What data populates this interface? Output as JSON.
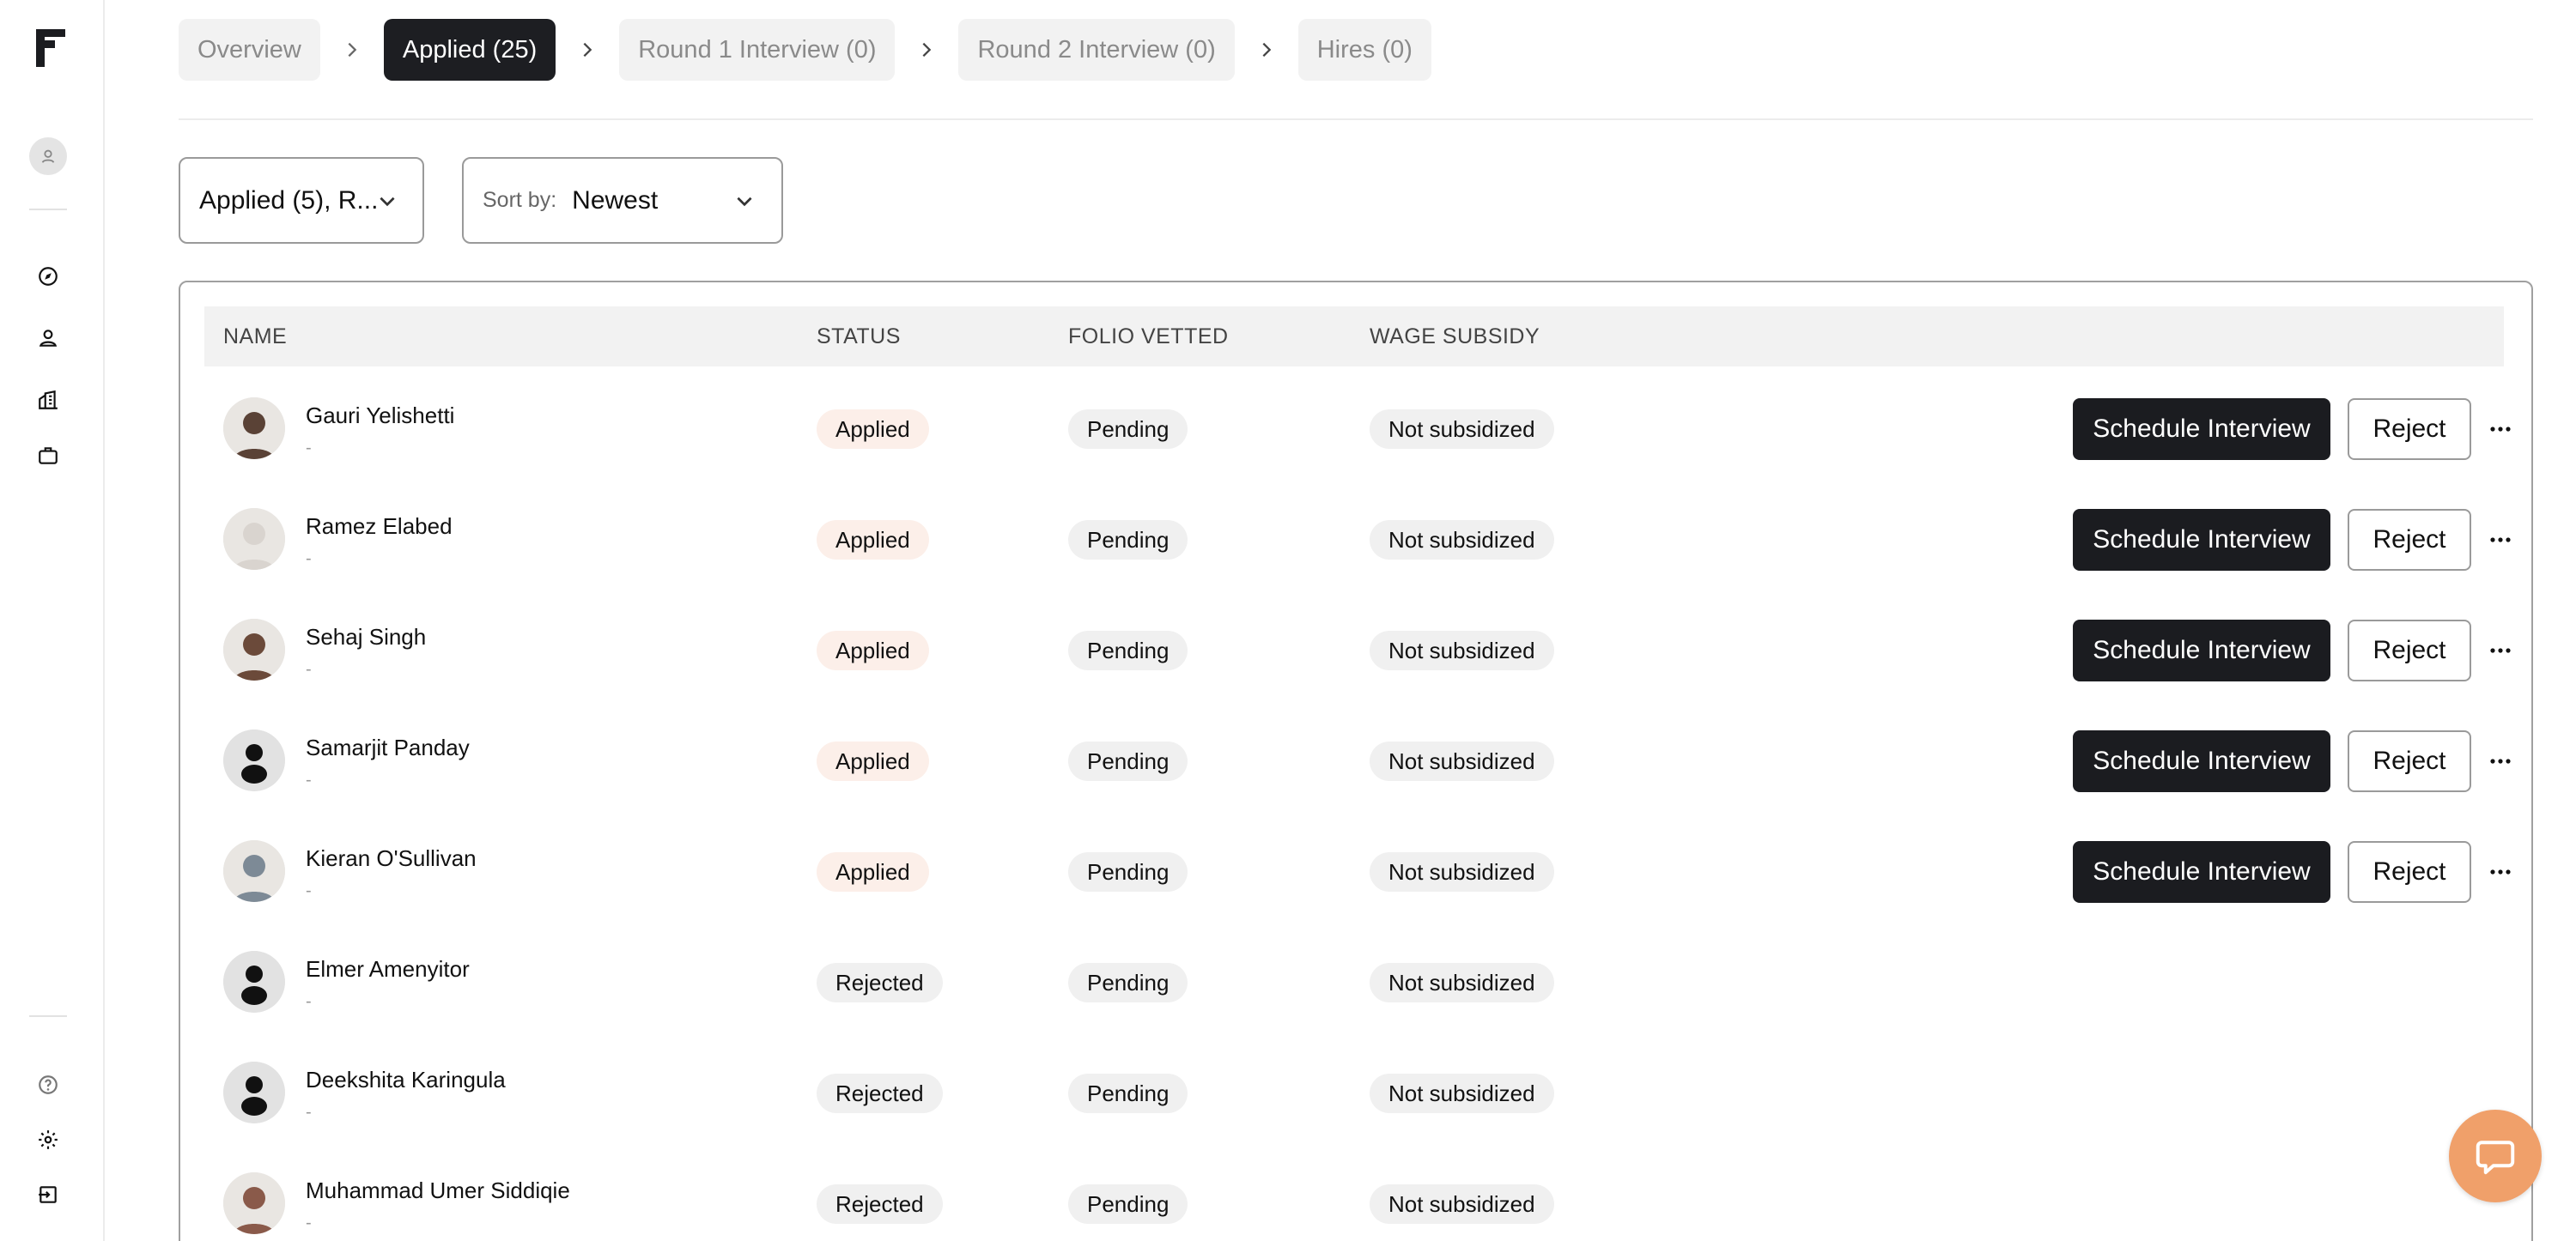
{
  "stages": [
    {
      "label": "Overview",
      "active": false
    },
    {
      "label": "Applied (25)",
      "active": true
    },
    {
      "label": "Round 1 Interview (0)",
      "active": false
    },
    {
      "label": "Round 2 Interview (0)",
      "active": false
    },
    {
      "label": "Hires (0)",
      "active": false
    }
  ],
  "filters": {
    "status_value": "Applied (5), R...",
    "sort_label": "Sort by:",
    "sort_value": "Newest"
  },
  "table": {
    "headers": {
      "name": "NAME",
      "status": "STATUS",
      "folio": "FOLIO VETTED",
      "wage": "WAGE SUBSIDY"
    },
    "actions": {
      "schedule": "Schedule Interview",
      "reject": "Reject"
    },
    "rows": [
      {
        "name": "Gauri Yelishetti",
        "sub": "-",
        "status": "Applied",
        "folio": "Pending",
        "wage": "Not subsidized",
        "avatar": "photo",
        "tone": "#5a4236"
      },
      {
        "name": "Ramez Elabed",
        "sub": "-",
        "status": "Applied",
        "folio": "Pending",
        "wage": "Not subsidized",
        "avatar": "photo",
        "tone": "#d9d4cf"
      },
      {
        "name": "Sehaj Singh",
        "sub": "-",
        "status": "Applied",
        "folio": "Pending",
        "wage": "Not subsidized",
        "avatar": "photo",
        "tone": "#6b4a3a"
      },
      {
        "name": "Samarjit Panday",
        "sub": "-",
        "status": "Applied",
        "folio": "Pending",
        "wage": "Not subsidized",
        "avatar": "default",
        "tone": "#e0e0e0"
      },
      {
        "name": "Kieran O'Sullivan",
        "sub": "-",
        "status": "Applied",
        "folio": "Pending",
        "wage": "Not subsidized",
        "avatar": "photo",
        "tone": "#7d8a96"
      },
      {
        "name": "Elmer Amenyitor",
        "sub": "-",
        "status": "Rejected",
        "folio": "Pending",
        "wage": "Not subsidized",
        "avatar": "default",
        "tone": "#e0e0e0"
      },
      {
        "name": "Deekshita Karingula",
        "sub": "-",
        "status": "Rejected",
        "folio": "Pending",
        "wage": "Not subsidized",
        "avatar": "default",
        "tone": "#e0e0e0"
      },
      {
        "name": "Muhammad Umer Siddiqie",
        "sub": "-",
        "status": "Rejected",
        "folio": "Pending",
        "wage": "Not subsidized",
        "avatar": "photo",
        "tone": "#8a5a4a"
      }
    ]
  },
  "colors": {
    "primary_button": "#1b1c20",
    "applied_pill": "#fcefe9",
    "neutral_pill": "#f0f0f0",
    "help_bubble": "#f0a06a"
  },
  "icons": {
    "sidebar_top": [
      "brand-logo",
      "user-avatar-icon"
    ],
    "sidebar_nav": [
      "compass-icon",
      "person-icon",
      "buildings-icon",
      "briefcase-icon"
    ],
    "sidebar_bottom": [
      "help-circle-icon",
      "gear-icon",
      "logout-icon"
    ],
    "help": "chat-bubble-icon"
  }
}
